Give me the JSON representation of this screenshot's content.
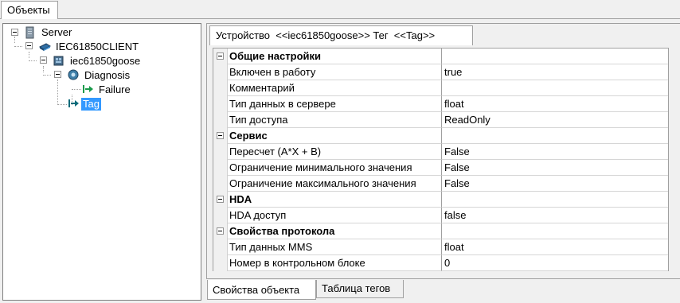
{
  "top_tabs": {
    "objects": "Объекты"
  },
  "tree": {
    "nodes": [
      {
        "label": "Server",
        "icon": "server-icon"
      },
      {
        "label": "IEC61850CLIENT",
        "icon": "network-client-icon"
      },
      {
        "label": "iec61850goose",
        "icon": "device-icon"
      },
      {
        "label": "Diagnosis",
        "icon": "diagnosis-icon"
      },
      {
        "label": "Failure",
        "icon": "tag-arrow-icon"
      },
      {
        "label": "Tag",
        "icon": "tag-arrow-icon"
      }
    ]
  },
  "document_tab": {
    "label": "Устройство  <<iec61850goose>> Тег  <<Tag>>"
  },
  "properties": {
    "rows": [
      {
        "name": "Общие настройки",
        "value": "",
        "category": true
      },
      {
        "name": "Включен в работу",
        "value": "true"
      },
      {
        "name": "Комментарий",
        "value": ""
      },
      {
        "name": "Тип данных в сервере",
        "value": "float"
      },
      {
        "name": "Тип доступа",
        "value": "ReadOnly"
      },
      {
        "name": "Сервис",
        "value": "",
        "category": true
      },
      {
        "name": "Пересчет (A*X + B)",
        "value": "False"
      },
      {
        "name": "Ограничение минимального значения",
        "value": "False"
      },
      {
        "name": "Ограничение максимального значения",
        "value": "False"
      },
      {
        "name": "HDA",
        "value": "",
        "category": true
      },
      {
        "name": "HDA доступ",
        "value": "false"
      },
      {
        "name": "Свойства протокола",
        "value": "",
        "category": true
      },
      {
        "name": "Тип данных MMS",
        "value": "float"
      },
      {
        "name": "Номер в контрольном блоке",
        "value": "0"
      }
    ]
  },
  "bottom_tabs": [
    {
      "label": "Свойства объекта"
    },
    {
      "label": "Таблица тегов"
    }
  ],
  "colors": {
    "selection": "#3399ff",
    "tag_arrow": "#1a9a4a",
    "tag_arrow_dark": "#0b6b7a"
  }
}
